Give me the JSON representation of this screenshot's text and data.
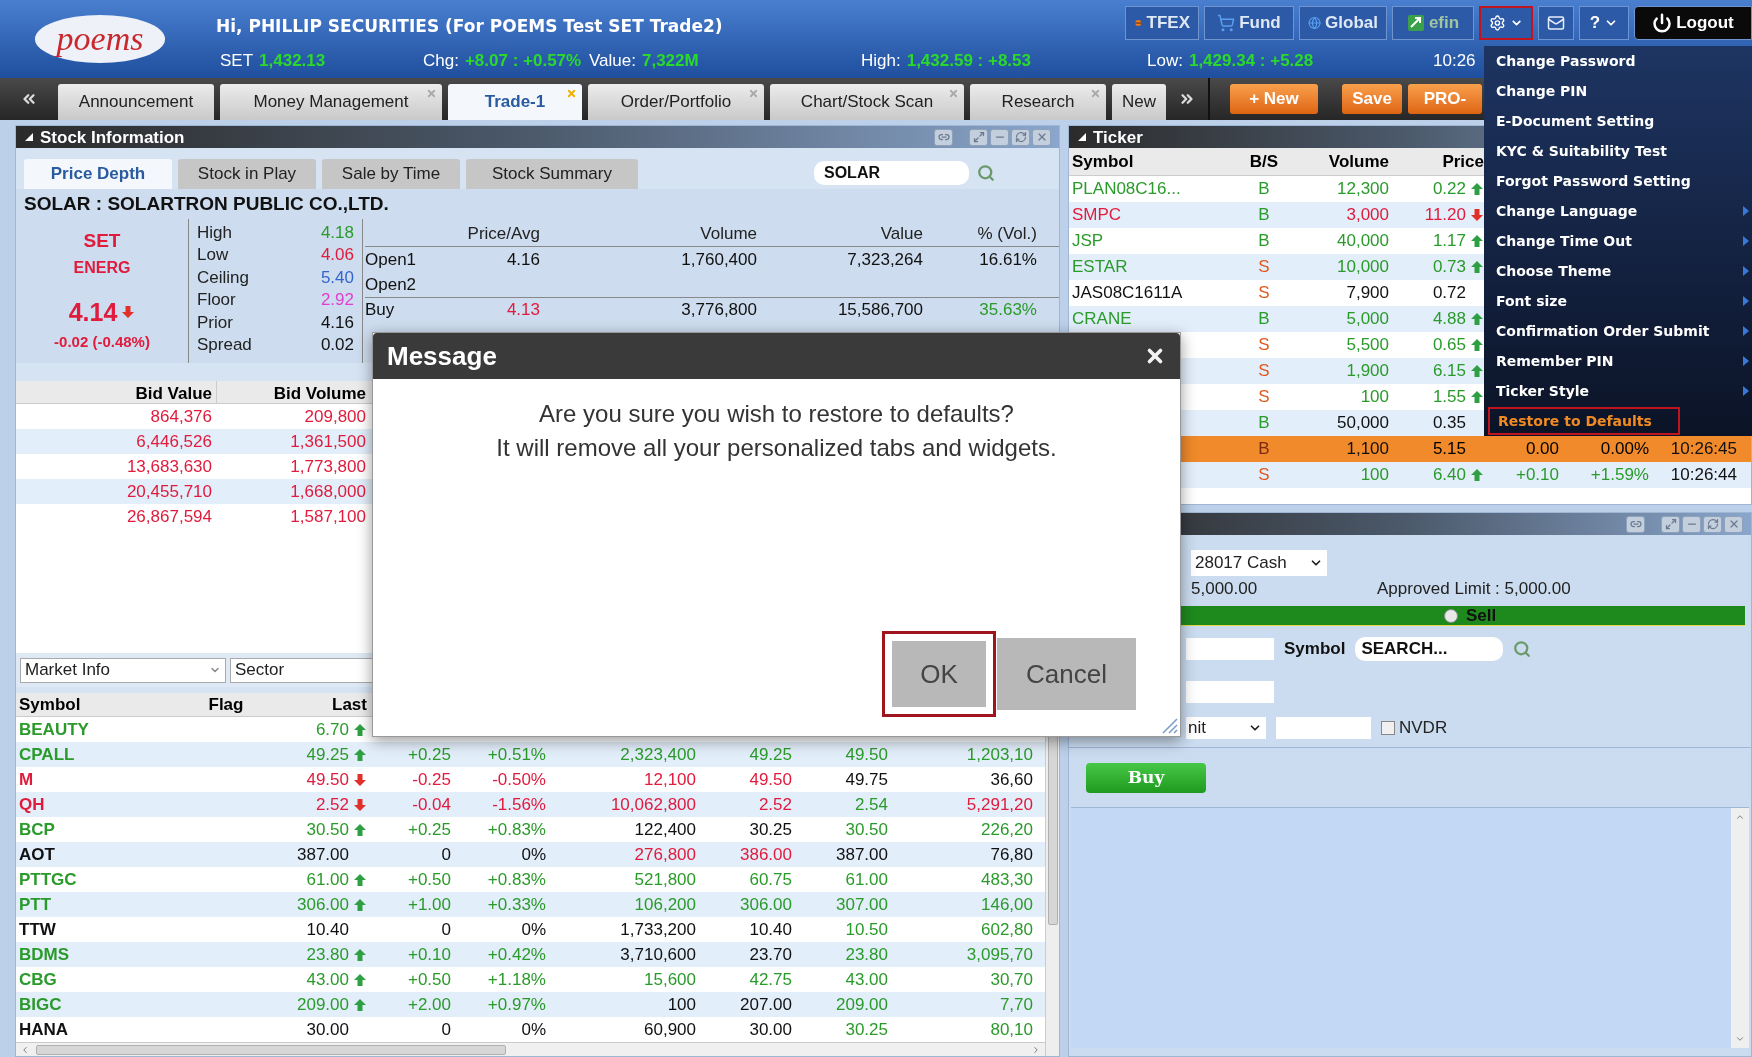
{
  "header": {
    "logo": "poems",
    "greeting": "Hi, PHILLIP SECURITIES (For POEMS Test SET Trade2)",
    "stats": [
      {
        "label": "SET",
        "value": "1,432.13"
      },
      {
        "label": "Chg:",
        "value": "+8.07 : +0.57%"
      },
      {
        "label": "Value:",
        "value": "7,322M"
      },
      {
        "label": "High:",
        "value": "1,432.59 : +8.53"
      },
      {
        "label": "Low:",
        "value": "1,429.34 : +5.28"
      }
    ],
    "time": "10:26",
    "toolbar": [
      {
        "kind": "tfex",
        "label": "TFEX",
        "highlighted": false
      },
      {
        "kind": "fund",
        "label": "Fund",
        "highlighted": false
      },
      {
        "kind": "global",
        "label": "Global",
        "highlighted": false
      },
      {
        "kind": "efin",
        "label": "efin",
        "highlighted": false
      },
      {
        "kind": "settings",
        "highlighted": true
      },
      {
        "kind": "mail",
        "highlighted": false
      },
      {
        "kind": "help",
        "label": "?",
        "highlighted": false
      },
      {
        "kind": "logout",
        "label": "Logout",
        "highlighted": false
      }
    ]
  },
  "tab_bar": {
    "tabs": [
      {
        "label": "Announcement",
        "selected": false,
        "closable": false
      },
      {
        "label": "Money Management",
        "selected": false,
        "closable": true
      },
      {
        "label": "Trade-1",
        "selected": true,
        "closable": true
      },
      {
        "label": "Order/Portfolio",
        "selected": false,
        "closable": true
      },
      {
        "label": "Chart/Stock Scan",
        "selected": false,
        "closable": true
      },
      {
        "label": "Research",
        "selected": false,
        "closable": true
      },
      {
        "label": "New",
        "selected": false,
        "closable": false
      }
    ],
    "actions": [
      "+ New",
      "Save",
      "PRO-"
    ]
  },
  "stock_info": {
    "title": "Stock Information",
    "tabs": [
      {
        "label": "Price Depth",
        "selected": true
      },
      {
        "label": "Stock in Play",
        "selected": false
      },
      {
        "label": "Sale by Time",
        "selected": false
      },
      {
        "label": "Stock Summary",
        "selected": false
      }
    ],
    "search_value": "SOLAR",
    "company": "SOLAR : SOLARTRON PUBLIC CO.,LTD.",
    "quote": {
      "kind": "down",
      "color": "#e01b3c",
      "market": "SET",
      "sector": "ENERG",
      "price": "4.14",
      "change": "-0.02 (-0.48%)"
    },
    "stats": [
      {
        "label": "High",
        "value": "4.18",
        "color": "#2a9a2a"
      },
      {
        "label": "Low",
        "value": "4.06",
        "color": "#e01b3c"
      },
      {
        "label": "Ceiling",
        "value": "5.40",
        "color": "#3366cc"
      },
      {
        "label": "Floor",
        "value": "2.92",
        "color": "#e040d0"
      },
      {
        "label": "Prior",
        "value": "4.16",
        "color": "#111111"
      },
      {
        "label": "Spread",
        "value": "0.02",
        "color": "#111111"
      }
    ],
    "depth": {
      "columns": [
        "Price/Avg",
        "Volume",
        "Value",
        "% (Vol.)"
      ],
      "rows": [
        {
          "label": "Open1",
          "cells": [
            {
              "text": "4.16",
              "color": "#111111"
            },
            {
              "text": "1,760,400",
              "color": "#111111"
            },
            {
              "text": "7,323,264",
              "color": "#111111"
            },
            {
              "text": "16.61%",
              "color": "#111111"
            }
          ]
        },
        {
          "label": "Open2"
        },
        {
          "label": "Buy",
          "cells": [
            {
              "text": "4.13",
              "color": "#e01b3c"
            },
            {
              "text": "3,776,800",
              "color": "#111111"
            },
            {
              "text": "15,586,700",
              "color": "#111111"
            },
            {
              "text": "35.63%",
              "color": "#2a9a2a"
            }
          ]
        }
      ]
    },
    "bids": {
      "columns": [
        "Bid Value",
        "Bid Volume"
      ],
      "rows": [
        {
          "value": "864,376",
          "volume": "209,800",
          "color": "#e01b3c"
        },
        {
          "value": "6,446,526",
          "volume": "1,361,500",
          "color": "#e01b3c"
        },
        {
          "value": "13,683,630",
          "volume": "1,773,800",
          "color": "#e01b3c"
        },
        {
          "value": "20,455,710",
          "volume": "1,668,000",
          "color": "#e01b3c"
        },
        {
          "value": "26,867,594",
          "volume": "1,587,100",
          "color": "#e01b3c"
        }
      ]
    }
  },
  "market_info": {
    "selects": [
      "Market Info",
      "Sector"
    ],
    "columns": [
      "Symbol",
      "Flag",
      "Last"
    ],
    "rows": [
      {
        "kind": "up",
        "symbol": "BEAUTY",
        "color": "#2a9a2a",
        "last": "6.70"
      },
      {
        "kind": "up",
        "symbol": "CPALL",
        "color": "#2a9a2a",
        "last": "49.25",
        "cells": [
          {
            "text": "+0.25",
            "color": "#2a9a2a"
          },
          {
            "text": "+0.51%",
            "color": "#2a9a2a"
          },
          {
            "text": "2,323,400",
            "color": "#2a9a2a"
          },
          {
            "text": "49.25",
            "color": "#2a9a2a"
          },
          {
            "text": "49.50",
            "color": "#2a9a2a"
          },
          {
            "text": "1,203,10",
            "color": "#2a9a2a"
          }
        ]
      },
      {
        "kind": "down",
        "symbol": "M",
        "color": "#e01b3c",
        "last": "49.50",
        "cells": [
          {
            "text": "-0.25",
            "color": "#e01b3c"
          },
          {
            "text": "-0.50%",
            "color": "#e01b3c"
          },
          {
            "text": "12,100",
            "color": "#e01b3c"
          },
          {
            "text": "49.50",
            "color": "#e01b3c"
          },
          {
            "text": "49.75",
            "color": "#111111"
          },
          {
            "text": "36,60",
            "color": "#111111"
          }
        ]
      },
      {
        "kind": "down",
        "symbol": "QH",
        "color": "#e01b3c",
        "last": "2.52",
        "cells": [
          {
            "text": "-0.04",
            "color": "#e01b3c"
          },
          {
            "text": "-1.56%",
            "color": "#e01b3c"
          },
          {
            "text": "10,062,800",
            "color": "#e01b3c"
          },
          {
            "text": "2.52",
            "color": "#e01b3c"
          },
          {
            "text": "2.54",
            "color": "#2a9a2a"
          },
          {
            "text": "5,291,20",
            "color": "#e01b3c"
          }
        ]
      },
      {
        "kind": "up",
        "symbol": "BCP",
        "color": "#2a9a2a",
        "last": "30.50",
        "cells": [
          {
            "text": "+0.25",
            "color": "#2a9a2a"
          },
          {
            "text": "+0.83%",
            "color": "#2a9a2a"
          },
          {
            "text": "122,400",
            "color": "#111111"
          },
          {
            "text": "30.25",
            "color": "#111111"
          },
          {
            "text": "30.50",
            "color": "#2a9a2a"
          },
          {
            "text": "226,20",
            "color": "#2a9a2a"
          }
        ]
      },
      {
        "kind": "flat",
        "symbol": "AOT",
        "color": "#111111",
        "last": "387.00",
        "cells": [
          {
            "text": "0",
            "color": "#111111"
          },
          {
            "text": "0%",
            "color": "#111111"
          },
          {
            "text": "276,800",
            "color": "#e01b3c"
          },
          {
            "text": "386.00",
            "color": "#e01b3c"
          },
          {
            "text": "387.00",
            "color": "#111111"
          },
          {
            "text": "76,80",
            "color": "#111111"
          }
        ]
      },
      {
        "kind": "up",
        "symbol": "PTTGC",
        "color": "#2a9a2a",
        "last": "61.00",
        "cells": [
          {
            "text": "+0.50",
            "color": "#2a9a2a"
          },
          {
            "text": "+0.83%",
            "color": "#2a9a2a"
          },
          {
            "text": "521,800",
            "color": "#2a9a2a"
          },
          {
            "text": "60.75",
            "color": "#2a9a2a"
          },
          {
            "text": "61.00",
            "color": "#2a9a2a"
          },
          {
            "text": "483,30",
            "color": "#2a9a2a"
          }
        ]
      },
      {
        "kind": "up",
        "symbol": "PTT",
        "color": "#2a9a2a",
        "last": "306.00",
        "cells": [
          {
            "text": "+1.00",
            "color": "#2a9a2a"
          },
          {
            "text": "+0.33%",
            "color": "#2a9a2a"
          },
          {
            "text": "106,200",
            "color": "#2a9a2a"
          },
          {
            "text": "306.00",
            "color": "#2a9a2a"
          },
          {
            "text": "307.00",
            "color": "#2a9a2a"
          },
          {
            "text": "146,00",
            "color": "#2a9a2a"
          }
        ]
      },
      {
        "kind": "flat",
        "symbol": "TTW",
        "color": "#111111",
        "last": "10.40",
        "cells": [
          {
            "text": "0",
            "color": "#111111"
          },
          {
            "text": "0%",
            "color": "#111111"
          },
          {
            "text": "1,733,200",
            "color": "#111111"
          },
          {
            "text": "10.40",
            "color": "#111111"
          },
          {
            "text": "10.50",
            "color": "#2a9a2a"
          },
          {
            "text": "602,80",
            "color": "#2a9a2a"
          }
        ]
      },
      {
        "kind": "up",
        "symbol": "BDMS",
        "color": "#2a9a2a",
        "last": "23.80",
        "cells": [
          {
            "text": "+0.10",
            "color": "#2a9a2a"
          },
          {
            "text": "+0.42%",
            "color": "#2a9a2a"
          },
          {
            "text": "3,710,600",
            "color": "#111111"
          },
          {
            "text": "23.70",
            "color": "#111111"
          },
          {
            "text": "23.80",
            "color": "#2a9a2a"
          },
          {
            "text": "3,095,70",
            "color": "#2a9a2a"
          }
        ]
      },
      {
        "kind": "up",
        "symbol": "CBG",
        "color": "#2a9a2a",
        "last": "43.00",
        "cells": [
          {
            "text": "+0.50",
            "color": "#2a9a2a"
          },
          {
            "text": "+1.18%",
            "color": "#2a9a2a"
          },
          {
            "text": "15,600",
            "color": "#2a9a2a"
          },
          {
            "text": "42.75",
            "color": "#2a9a2a"
          },
          {
            "text": "43.00",
            "color": "#2a9a2a"
          },
          {
            "text": "30,70",
            "color": "#2a9a2a"
          }
        ]
      },
      {
        "kind": "up",
        "symbol": "BIGC",
        "color": "#2a9a2a",
        "last": "209.00",
        "cells": [
          {
            "text": "+2.00",
            "color": "#2a9a2a"
          },
          {
            "text": "+0.97%",
            "color": "#2a9a2a"
          },
          {
            "text": "100",
            "color": "#111111"
          },
          {
            "text": "207.00",
            "color": "#111111"
          },
          {
            "text": "209.00",
            "color": "#2a9a2a"
          },
          {
            "text": "7,70",
            "color": "#2a9a2a"
          }
        ]
      },
      {
        "kind": "flat",
        "symbol": "HANA",
        "color": "#111111",
        "last": "30.00",
        "cells": [
          {
            "text": "0",
            "color": "#111111"
          },
          {
            "text": "0%",
            "color": "#111111"
          },
          {
            "text": "60,900",
            "color": "#111111"
          },
          {
            "text": "30.00",
            "color": "#111111"
          },
          {
            "text": "30.25",
            "color": "#2a9a2a"
          },
          {
            "text": "80,10",
            "color": "#2a9a2a"
          }
        ]
      }
    ]
  },
  "ticker": {
    "title": "Ticker",
    "columns": [
      "Symbol",
      "B/S",
      "Volume",
      "Price"
    ],
    "rows": [
      {
        "kind": "up",
        "symbol": "PLAN08C16...",
        "side": {
          "text": "B",
          "color": "#2a9a2a"
        },
        "volume": "12,300",
        "price": "0.22",
        "color": "#2a9a2a",
        "highlighted": false
      },
      {
        "kind": "down",
        "symbol": "SMPC",
        "side": {
          "text": "B",
          "color": "#2a9a2a"
        },
        "volume": "3,000",
        "price": "11.20",
        "color": "#e01b3c",
        "highlighted": false
      },
      {
        "kind": "up",
        "symbol": "JSP",
        "side": {
          "text": "B",
          "color": "#2a9a2a"
        },
        "volume": "40,000",
        "price": "1.17",
        "color": "#2a9a2a",
        "highlighted": false
      },
      {
        "kind": "up",
        "symbol": "ESTAR",
        "side": {
          "text": "S",
          "color": "#e05a20"
        },
        "volume": "10,000",
        "price": "0.73",
        "color": "#2a9a2a",
        "highlighted": false
      },
      {
        "kind": "flat",
        "symbol": "JAS08C1611A",
        "side": {
          "text": "S",
          "color": "#e05a20"
        },
        "volume": "7,900",
        "price": "0.72",
        "color": "#111111",
        "highlighted": false
      },
      {
        "kind": "up",
        "symbol": "CRANE",
        "side": {
          "text": "B",
          "color": "#2a9a2a"
        },
        "volume": "5,000",
        "price": "4.88",
        "color": "#2a9a2a",
        "highlighted": false
      },
      {
        "kind": "up",
        "side": {
          "text": "S",
          "color": "#e05a20"
        },
        "volume": "5,500",
        "price": "0.65",
        "color": "#2a9a2a",
        "highlighted": false
      },
      {
        "kind": "up",
        "side": {
          "text": "S",
          "color": "#e05a20"
        },
        "volume": "1,900",
        "price": "6.15",
        "color": "#2a9a2a",
        "highlighted": false
      },
      {
        "kind": "up",
        "side": {
          "text": "S",
          "color": "#e05a20"
        },
        "volume": "100",
        "price": "1.55",
        "color": "#2a9a2a",
        "highlighted": false
      },
      {
        "kind": "flat",
        "side": {
          "text": "B",
          "color": "#2a9a2a"
        },
        "volume": "50,000",
        "price": "0.35",
        "color": "#111111",
        "highlighted": false
      },
      {
        "kind": "flat",
        "side": {
          "text": "B"
        },
        "volume": "1,100",
        "price": "5.15",
        "highlighted": true,
        "change": "0.00",
        "change_pct": "0.00%",
        "time": "10:26:45"
      },
      {
        "kind": "up",
        "side": {
          "text": "S",
          "color": "#e05a20"
        },
        "volume": "100",
        "price": "6.40",
        "color": "#2a9a2a",
        "highlighted": false,
        "change": "+0.10",
        "change_pct": "+1.59%",
        "time": "10:26:44"
      }
    ]
  },
  "order": {
    "account": "28017 Cash",
    "limit": "5,000.00",
    "approved": "Approved Limit : 5,000.00",
    "side_radio": {
      "label": "Sell",
      "selected": false
    },
    "symbol_label": "Symbol",
    "symbol_placeholder": "SEARCH...",
    "order_type": "nit",
    "nvdr": {
      "label": "NVDR",
      "checked": false
    },
    "submit": "Buy"
  },
  "menu": {
    "items": [
      {
        "label": "Change Password",
        "submenu": false,
        "highlighted": false
      },
      {
        "label": "Change PIN",
        "submenu": false,
        "highlighted": false
      },
      {
        "label": "E-Document Setting",
        "submenu": false,
        "highlighted": false
      },
      {
        "label": "KYC & Suitability Test",
        "submenu": false,
        "highlighted": false
      },
      {
        "label": "Forgot Password Setting",
        "submenu": false,
        "highlighted": false
      },
      {
        "label": "Change Language",
        "submenu": true,
        "highlighted": false
      },
      {
        "label": "Change Time Out",
        "submenu": true,
        "highlighted": false
      },
      {
        "label": "Choose Theme",
        "submenu": true,
        "highlighted": false
      },
      {
        "label": "Font size",
        "submenu": true,
        "highlighted": false
      },
      {
        "label": "Confirmation Order Submit",
        "submenu": true,
        "highlighted": false
      },
      {
        "label": "Remember PIN",
        "submenu": true,
        "highlighted": false
      },
      {
        "label": "Ticker Style",
        "submenu": true,
        "highlighted": false
      },
      {
        "label": "Restore to Defaults",
        "submenu": false,
        "highlighted": true
      }
    ]
  },
  "dialog": {
    "title": "Message",
    "lines": [
      "Are you sure you wish to restore to defaults?",
      "It will remove all your personalized tabs and widgets."
    ],
    "buttons": [
      {
        "label": "OK",
        "highlighted": true
      },
      {
        "label": "Cancel",
        "highlighted": false
      }
    ]
  }
}
